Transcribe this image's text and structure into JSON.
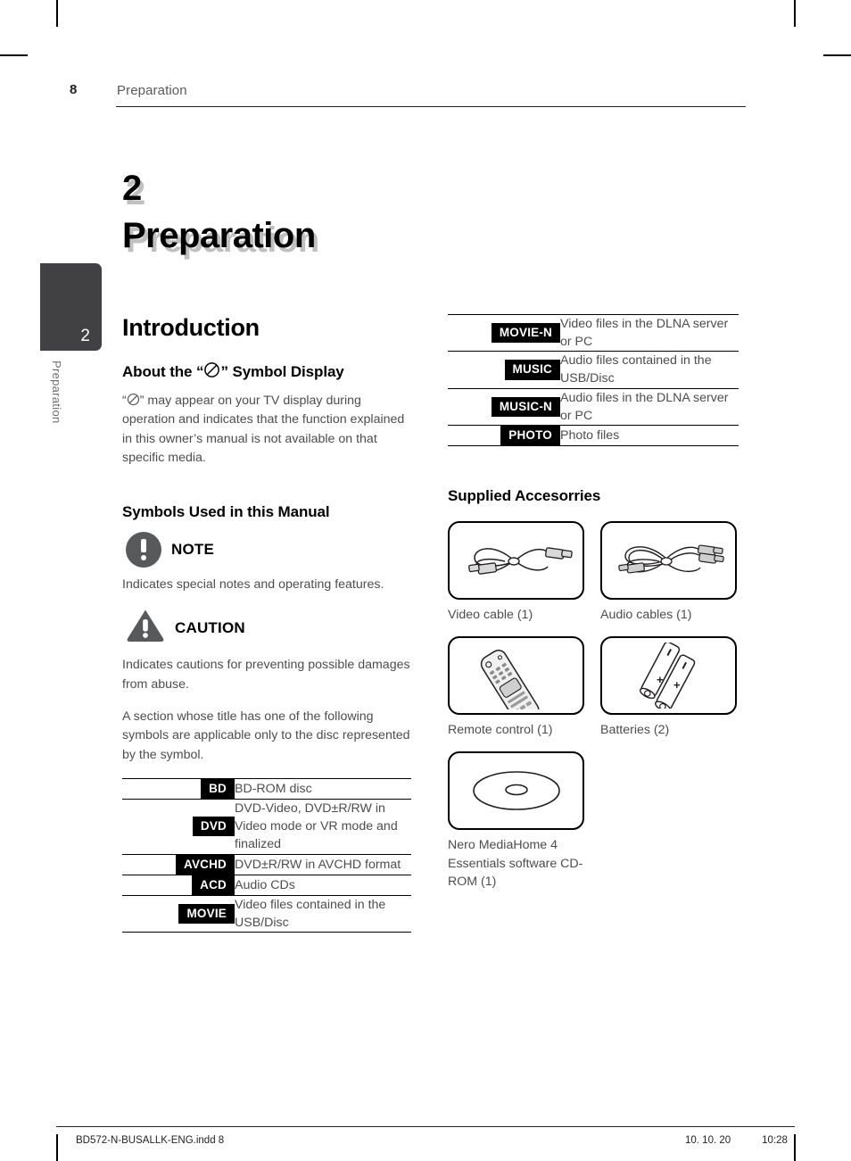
{
  "header": {
    "page_number": "8",
    "section": "Preparation"
  },
  "chapter": {
    "number": "2",
    "title": "Preparation"
  },
  "side_tab": {
    "number": "2",
    "label": "Preparation"
  },
  "main": {
    "section_title": "Introduction",
    "about_symbol": {
      "heading_before": "About the “",
      "heading_after": "” Symbol Display",
      "body_before": "“",
      "body_after": "” may appear on your TV display during operation and indicates that the function explained in this owner’s manual is not available on that specific media.",
      "symbol_name": "prohibition-symbol"
    },
    "symbols_used": {
      "heading": "Symbols Used in this Manual",
      "note_label": "NOTE",
      "note_text": "Indicates special notes and operating features.",
      "caution_label": "CAUTION",
      "caution_text": "Indicates cautions for preventing possible damages from abuse.",
      "intro_text": "A section whose title has one of the following symbols are applicable only to the disc represented by the symbol."
    },
    "symbol_table_left": [
      {
        "badge": "BD",
        "description": "BD-ROM disc"
      },
      {
        "badge": "DVD",
        "description": "DVD-Video, DVD±R/RW in Video mode or VR mode and finalized"
      },
      {
        "badge": "AVCHD",
        "description": "DVD±R/RW in AVCHD format"
      },
      {
        "badge": "ACD",
        "description": "Audio CDs"
      },
      {
        "badge": "MOVIE",
        "description": "Video files contained in the USB/Disc"
      }
    ],
    "symbol_table_right": [
      {
        "badge": "MOVIE-N",
        "description": "Video files in the DLNA server or PC"
      },
      {
        "badge": "MUSIC",
        "description": "Audio files contained in the USB/Disc"
      },
      {
        "badge": "MUSIC-N",
        "description": "Audio files in the DLNA server or PC"
      },
      {
        "badge": "PHOTO",
        "description": "Photo files"
      }
    ],
    "accessories": {
      "heading": "Supplied Accesorries",
      "items": [
        {
          "caption": "Video cable (1)",
          "icon": "video-cable-illustration"
        },
        {
          "caption": "Audio cables (1)",
          "icon": "audio-cables-illustration"
        },
        {
          "caption": "Remote control (1)",
          "icon": "remote-control-illustration"
        },
        {
          "caption": "Batteries (2)",
          "icon": "batteries-illustration"
        },
        {
          "caption": "Nero MediaHome 4 Essentials software CD-ROM (1)",
          "icon": "cd-rom-disc-illustration"
        }
      ]
    }
  },
  "footer": {
    "file_name": "BD572-N-BUSALLK-ENG.indd   8",
    "date": "10. 10. 20",
    "time": "10:28"
  },
  "colors": {
    "text": "#231f20",
    "body_text": "#4d4d4f",
    "tab_background": "#414042",
    "badge_background": "#000000",
    "icon_gray": "#58595b"
  }
}
